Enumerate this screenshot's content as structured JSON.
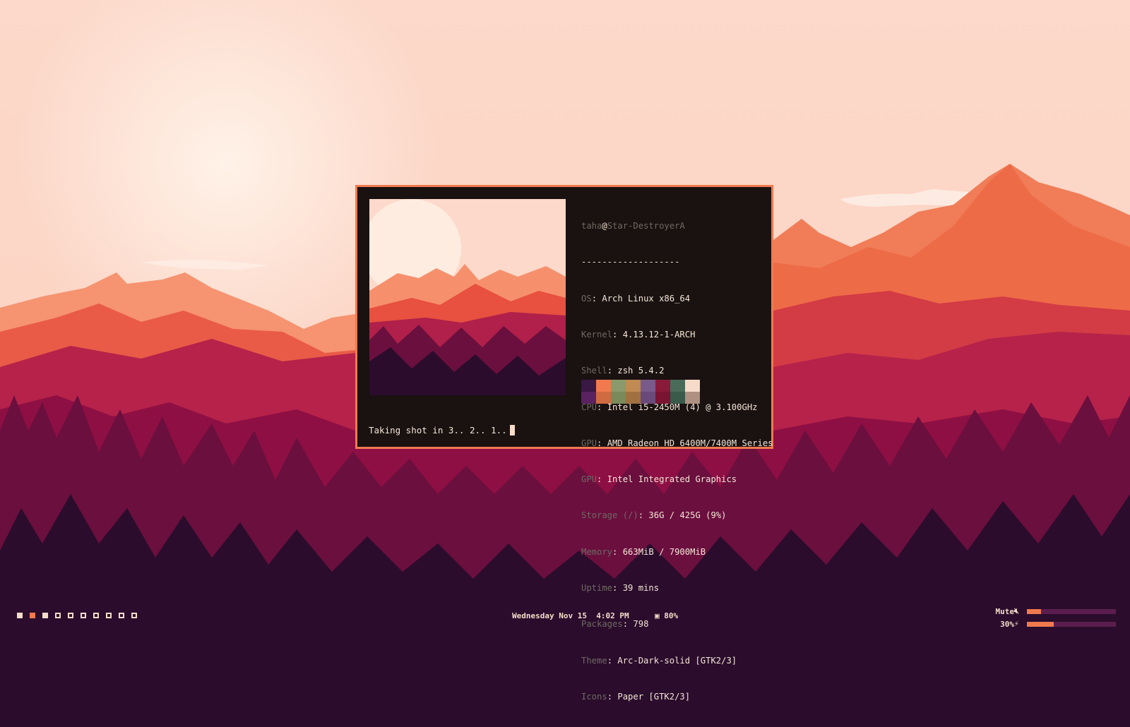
{
  "desktop": {
    "accent_color": "#f07a4e",
    "bar_text_color": "#f6dcc8"
  },
  "terminal": {
    "user": "taha",
    "at": "@",
    "host": "Star-DestroyerA",
    "separator": "-------------------",
    "info": [
      {
        "key": "OS",
        "value": "Arch Linux x86_64"
      },
      {
        "key": "Kernel",
        "value": "4.13.12-1-ARCH"
      },
      {
        "key": "Shell",
        "value": "zsh 5.4.2"
      },
      {
        "key": "CPU",
        "value": "Intel i5-2450M (4) @ 3.100GHz"
      },
      {
        "key": "GPU",
        "value": "AMD Radeon HD 6400M/7400M Series"
      },
      {
        "key": "GPU",
        "value": "Intel Integrated Graphics"
      },
      {
        "key": "Storage (/)",
        "value": "36G / 425G (9%)"
      },
      {
        "key": "Memory",
        "value": "663MiB / 7900MiB"
      },
      {
        "key": "Uptime",
        "value": "39 mins"
      },
      {
        "key": "Packages",
        "value": "798"
      },
      {
        "key": "Theme",
        "value": "Arc-Dark-solid [GTK2/3]"
      },
      {
        "key": "Icons",
        "value": "Paper [GTK2/3]"
      }
    ],
    "palette_top": [
      "#3a1844",
      "#f07a4e",
      "#8a9a6a",
      "#c08a52",
      "#7a5a8a",
      "#8a1a3a",
      "#4a6a5a",
      "#f6dcc8"
    ],
    "palette_bottom": [
      "#5a2260",
      "#d06a40",
      "#7a8a5a",
      "#a07040",
      "#6a4a7a",
      "#7a1432",
      "#3a5a4a",
      "#b09080"
    ],
    "prompt_text": "Taking shot in 3.. 2.. 1.."
  },
  "bar": {
    "workspaces": [
      {
        "state": "full"
      },
      {
        "state": "active"
      },
      {
        "state": "full"
      },
      {
        "state": "empty"
      },
      {
        "state": "empty"
      },
      {
        "state": "empty"
      },
      {
        "state": "empty"
      },
      {
        "state": "empty"
      },
      {
        "state": "empty"
      },
      {
        "state": "empty"
      }
    ],
    "clock": "Wednesday Nov 15  4:02 PM",
    "battery_icon": "battery-icon",
    "battery": "80%",
    "volume_label": "Mute",
    "volume_icon": "speaker-mute-icon",
    "volume_level": 0.16,
    "brightness_label": "30%",
    "brightness_icon": "lightning-icon",
    "brightness_level": 0.3
  }
}
